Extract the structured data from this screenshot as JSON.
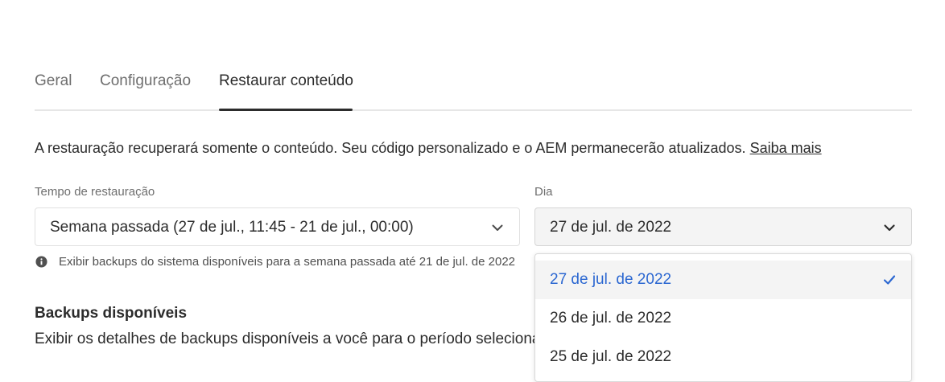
{
  "tabs": [
    {
      "label": "Geral"
    },
    {
      "label": "Configuração"
    },
    {
      "label": "Restaurar conteúdo",
      "active": true
    }
  ],
  "description": {
    "text": "A restauração recuperará somente o conteúdo. Seu código personalizado e o AEM permanecerão atualizados.",
    "link": "Saiba mais"
  },
  "restore_time": {
    "label": "Tempo de restauração",
    "value": "Semana passada (27 de jul., 11:45 - 21 de jul., 00:00)",
    "icon": "chevron-down-icon"
  },
  "day": {
    "label": "Dia",
    "value": "27 de jul. de 2022",
    "icon": "chevron-down-icon"
  },
  "help": {
    "icon": "info-icon",
    "text": "Exibir backups do sistema disponíveis para a semana passada até 21 de jul. de 2022"
  },
  "backups": {
    "title": "Backups disponíveis",
    "text": "Exibir os detalhes de backups disponíveis a você para o período selecionado"
  },
  "day_menu": {
    "items": [
      {
        "label": "27 de jul. de 2022",
        "selected": true
      },
      {
        "label": "26 de jul. de 2022"
      },
      {
        "label": "25 de jul. de 2022"
      }
    ],
    "check_icon": "checkmark-icon"
  },
  "colors": {
    "accent": "#2b67d1",
    "text": "#2c2c2c",
    "muted": "#6e6e6e"
  }
}
